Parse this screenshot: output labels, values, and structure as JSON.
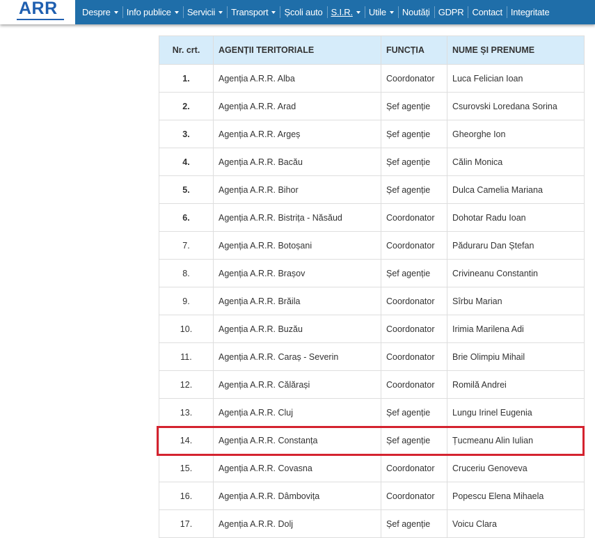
{
  "header": {
    "logo": "ARR",
    "nav": [
      {
        "label": "Despre",
        "dropdown": true
      },
      {
        "label": "Info publice",
        "dropdown": true
      },
      {
        "label": "Servicii",
        "dropdown": true
      },
      {
        "label": "Transport",
        "dropdown": true
      },
      {
        "label": "Școli auto",
        "dropdown": false
      },
      {
        "label": "S.I.R.",
        "dropdown": true,
        "underlined": true
      },
      {
        "label": "Utile",
        "dropdown": true
      },
      {
        "label": "Noutăți",
        "dropdown": false
      },
      {
        "label": "GDPR",
        "dropdown": false
      },
      {
        "label": "Contact",
        "dropdown": false
      },
      {
        "label": "Integritate",
        "dropdown": false
      }
    ]
  },
  "table": {
    "headers": [
      "Nr. crt.",
      "AGENȚII TERITORIALE",
      "FUNCȚIA",
      "NUME ȘI PRENUME"
    ],
    "rows": [
      {
        "nr": "1.",
        "agency": "Agenția A.R.R. Alba",
        "role": "Coordonator",
        "name": "Luca Felician Ioan",
        "bold": true
      },
      {
        "nr": "2.",
        "agency": "Agenția A.R.R. Arad",
        "role": "Șef agenție",
        "name": "Csurovski Loredana Sorina",
        "bold": true
      },
      {
        "nr": "3.",
        "agency": "Agenția A.R.R. Argeș",
        "role": "Șef agenție",
        "name": "Gheorghe Ion",
        "bold": true
      },
      {
        "nr": "4.",
        "agency": "Agenția A.R.R. Bacău",
        "role": "Șef agenție",
        "name": "Călin Monica",
        "bold": true
      },
      {
        "nr": "5.",
        "agency": "Agenția A.R.R. Bihor",
        "role": "Șef agenție",
        "name": "Dulca Camelia Mariana",
        "bold": true
      },
      {
        "nr": "6.",
        "agency": "Agenția A.R.R. Bistrița - Năsăud",
        "role": "Coordonator",
        "name": "Dohotar Radu Ioan",
        "bold": true
      },
      {
        "nr": "7.",
        "agency": "Agenția A.R.R. Botoșani",
        "role": "Coordonator",
        "name": "Păduraru Dan Ștefan",
        "bold": false
      },
      {
        "nr": "8.",
        "agency": "Agenția A.R.R. Brașov",
        "role": "Șef agenție",
        "name": "Crivineanu Constantin",
        "bold": false
      },
      {
        "nr": "9.",
        "agency": "Agenția A.R.R. Brăila",
        "role": "Coordonator",
        "name": "Sîrbu Marian",
        "bold": false
      },
      {
        "nr": "10.",
        "agency": "Agenția A.R.R. Buzău",
        "role": "Coordonator",
        "name": "Irimia Marilena Adi",
        "bold": false
      },
      {
        "nr": "11.",
        "agency": "Agenția A.R.R. Caraș - Severin",
        "role": "Coordonator",
        "name": "Brie Olimpiu Mihail",
        "bold": false
      },
      {
        "nr": "12.",
        "agency": "Agenția A.R.R. Călărași",
        "role": "Coordonator",
        "name": "Romilă Andrei",
        "bold": false
      },
      {
        "nr": "13.",
        "agency": "Agenția A.R.R. Cluj",
        "role": "Șef agenție",
        "name": "Lungu Irinel Eugenia",
        "bold": false
      },
      {
        "nr": "14.",
        "agency": "Agenția A.R.R. Constanța",
        "role": "Șef agenție",
        "name": "Țucmeanu Alin Iulian",
        "bold": false,
        "highlighted": true
      },
      {
        "nr": "15.",
        "agency": "Agenția A.R.R. Covasna",
        "role": "Coordonator",
        "name": "Cruceriu Genoveva",
        "bold": false
      },
      {
        "nr": "16.",
        "agency": "Agenția A.R.R. Dâmbovița",
        "role": "Coordonator",
        "name": "Popescu Elena Mihaela",
        "bold": false
      },
      {
        "nr": "17.",
        "agency": "Agenția A.R.R. Dolj",
        "role": "Șef agenție",
        "name": "Voicu Clara",
        "bold": false
      }
    ]
  },
  "colors": {
    "navbar": "#1f6ea9",
    "logo": "#1f5fb0",
    "table_header": "#d6ecfa",
    "highlight": "#d4232f"
  }
}
